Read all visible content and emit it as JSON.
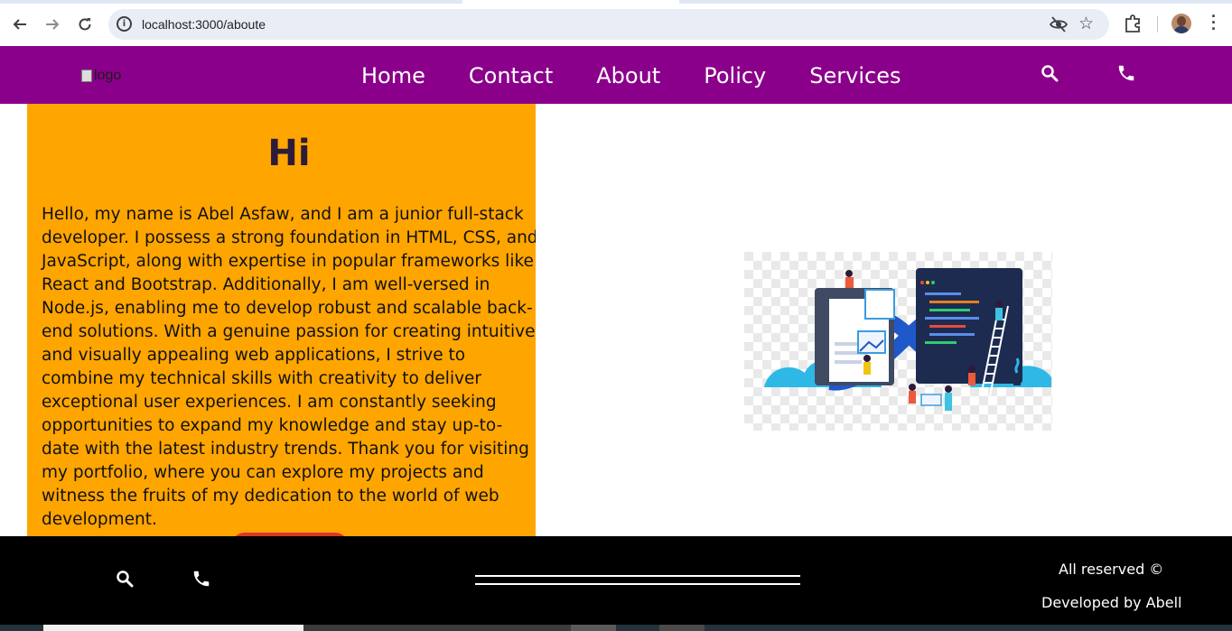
{
  "browser": {
    "url": "localhost:3000/aboute",
    "back_icon": "arrow-left-icon",
    "forward_icon": "arrow-right-icon",
    "reload_icon": "reload-icon"
  },
  "navbar": {
    "logo_alt": "logo",
    "links": [
      "Home",
      "Contact",
      "About",
      "Policy",
      "Services"
    ],
    "background": "#8b008b"
  },
  "about": {
    "heading": "Hi",
    "body": "Hello, my name is Abel Asfaw, and I am a junior full-stack developer. I possess a strong foundation in HTML, CSS, and JavaScript, along with expertise in popular frameworks like React and Bootstrap. Additionally, I am well-versed in Node.js, enabling me to develop robust and scalable back-end solutions. With a genuine passion for creating intuitive and visually appealing web applications, I strive to combine my technical skills with creativity to deliver exceptional user experiences. I am constantly seeking opportunities to expand my knowledge and stay up-to-date with the latest industry trends. Thank you for visiting my portfolio, where you can explore my projects and witness the fruits of my dedication to the world of web development.",
    "background": "#ffa500"
  },
  "footer": {
    "rights": "All reserved ©",
    "developer": "Developed by Abell"
  }
}
